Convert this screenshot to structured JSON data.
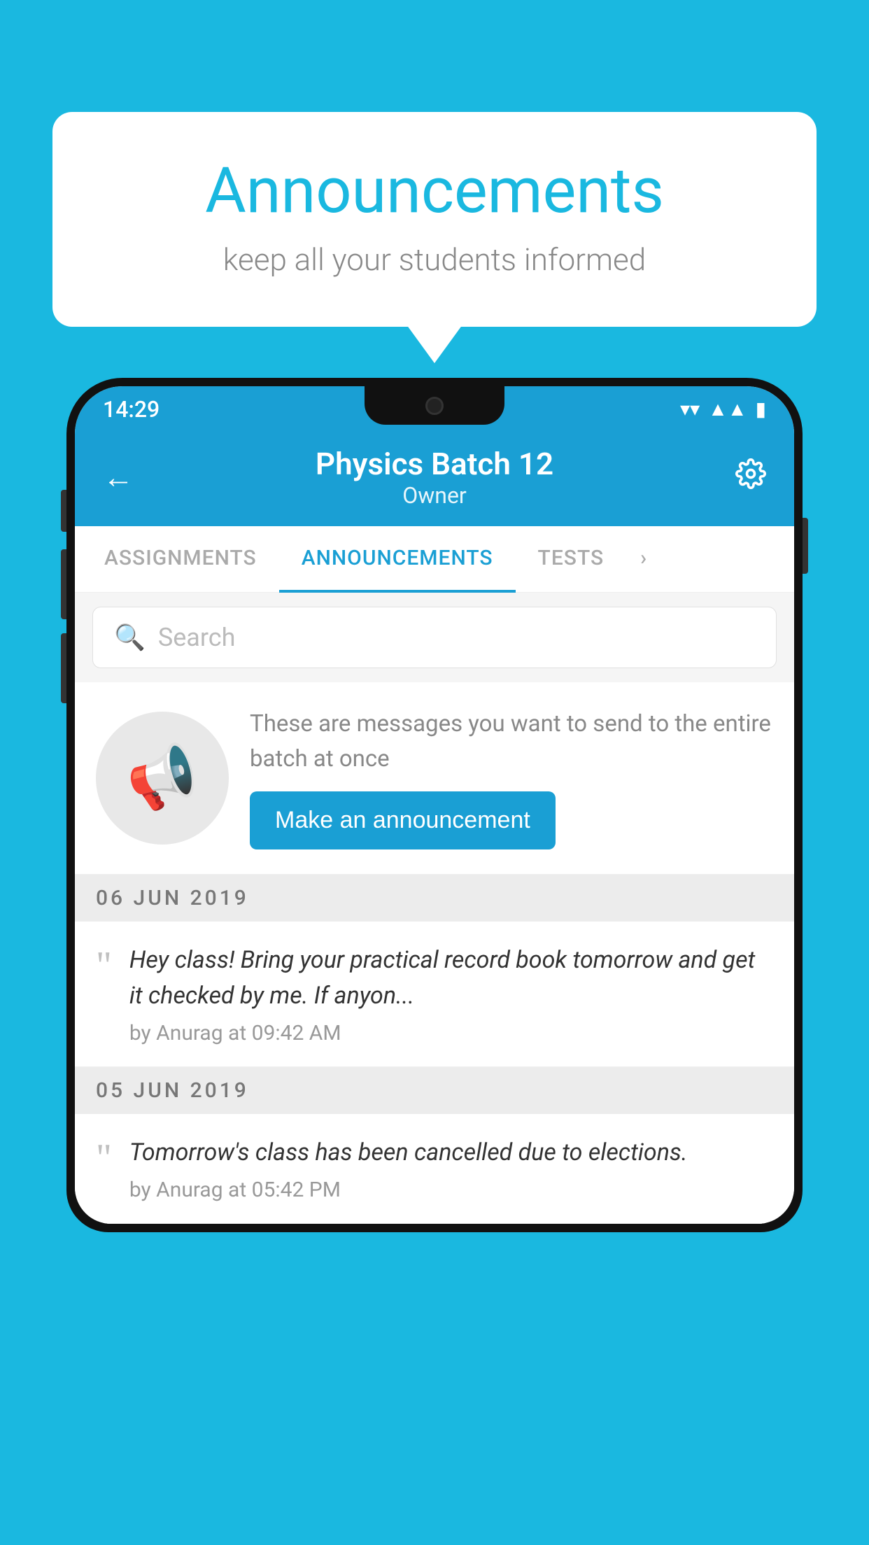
{
  "page": {
    "background_color": "#1ab8e0"
  },
  "speech_bubble": {
    "title": "Announcements",
    "subtitle": "keep all your students informed"
  },
  "phone": {
    "status_bar": {
      "time": "14:29",
      "wifi": "▼",
      "signal": "▲",
      "battery": "▮"
    },
    "header": {
      "back_label": "←",
      "title": "Physics Batch 12",
      "subtitle": "Owner",
      "gear_label": "⚙"
    },
    "tabs": [
      {
        "label": "ASSIGNMENTS",
        "active": false
      },
      {
        "label": "ANNOUNCEMENTS",
        "active": true
      },
      {
        "label": "TESTS",
        "active": false
      },
      {
        "label": "›",
        "active": false
      }
    ],
    "search": {
      "placeholder": "Search"
    },
    "promo_card": {
      "description": "These are messages you want to send to the entire batch at once",
      "button_label": "Make an announcement"
    },
    "announcements": [
      {
        "date": "06  JUN  2019",
        "items": [
          {
            "text": "Hey class! Bring your practical record book tomorrow and get it checked by me. If anyon...",
            "meta": "by Anurag at 09:42 AM"
          }
        ]
      },
      {
        "date": "05  JUN  2019",
        "items": [
          {
            "text": "Tomorrow's class has been cancelled due to elections.",
            "meta": "by Anurag at 05:42 PM"
          }
        ]
      }
    ]
  }
}
